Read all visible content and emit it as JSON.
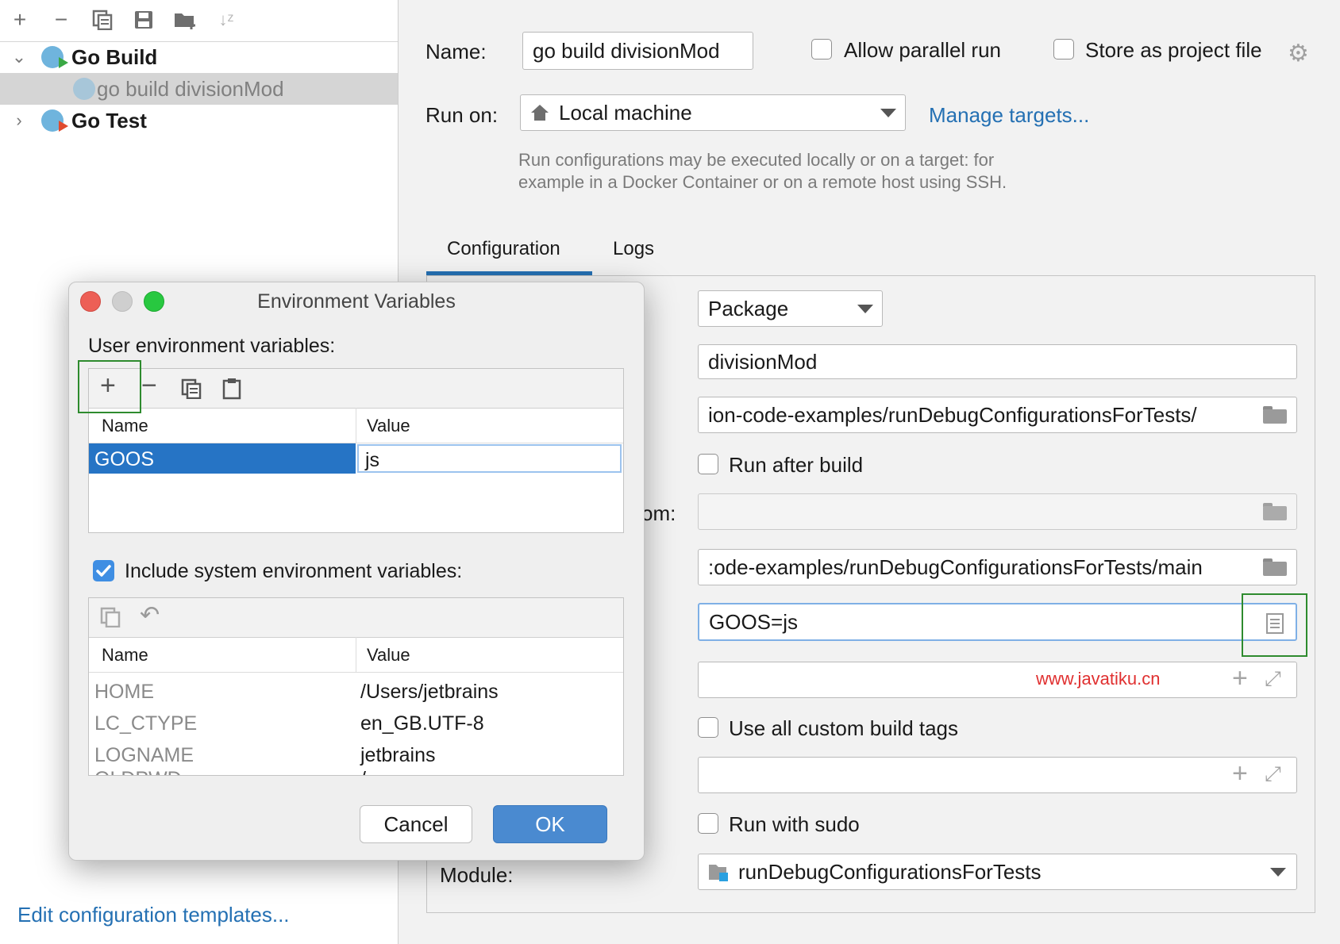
{
  "left": {
    "toolbar_icons": [
      "plus-icon",
      "minus-icon",
      "copy-icon",
      "save-icon",
      "folder-add-icon",
      "sort-icon"
    ],
    "tree": [
      {
        "label": "Go Build",
        "expanded": true
      },
      {
        "label": "go build divisionMod",
        "selected": true
      },
      {
        "label": "Go Test",
        "expanded": false
      }
    ],
    "edit_templates": "Edit configuration templates..."
  },
  "right": {
    "name_label": "Name:",
    "name_value": "go build divisionMod",
    "allow_parallel": "Allow parallel run",
    "store_project": "Store as project file",
    "run_on_label": "Run on:",
    "run_on_value": "Local machine",
    "manage_targets": "Manage targets...",
    "hint_line1": "Run configurations may be executed locally or on a target: for",
    "hint_line2": "example in a Docker Container or on a remote host using SSH.",
    "tabs": [
      "Configuration",
      "Logs"
    ],
    "run_kind": "Package",
    "package_path": "divisionMod",
    "working_dir": "ion-code-examples/runDebugConfigurationsForTests/",
    "run_after_build": "Run after build",
    "partial_label": "om:",
    "output_dir": ":ode-examples/runDebugConfigurationsForTests/main",
    "env_value": "GOOS=js",
    "watermark": "www.javatiku.cn",
    "use_custom_tags": "Use all custom build tags",
    "run_with_sudo": "Run with sudo",
    "module_label": "Module:",
    "module_value": "runDebugConfigurationsForTests"
  },
  "dialog": {
    "title": "Environment Variables",
    "user_label": "User environment variables:",
    "col_name": "Name",
    "col_value": "Value",
    "user_rows": [
      {
        "name": "GOOS",
        "value": "js"
      }
    ],
    "include_system": "Include system environment variables:",
    "system_rows": [
      {
        "name": "HOME",
        "value": "/Users/jetbrains"
      },
      {
        "name": "LC_CTYPE",
        "value": "en_GB.UTF-8"
      },
      {
        "name": "LOGNAME",
        "value": "jetbrains"
      },
      {
        "name": "OLDPWD",
        "value": "/"
      }
    ],
    "cancel": "Cancel",
    "ok": "OK"
  },
  "colors": {
    "accent": "#2470b3",
    "ok_button": "#4a8ad0",
    "selection": "#2674c5",
    "highlight": "#2e8b2e"
  }
}
